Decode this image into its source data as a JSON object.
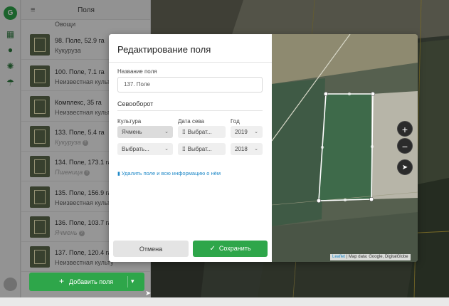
{
  "rail": {
    "logo_letter": "G",
    "icons": [
      "grid-icon",
      "pin-icon",
      "sun-icon",
      "umbrella-icon"
    ]
  },
  "panel": {
    "title": "Поля",
    "top_partial_crop": "Овощи",
    "fields": [
      {
        "name": "98. Поле, 52.9 га",
        "crop": "Кукуруза",
        "muted": false
      },
      {
        "name": "100. Поле, 7.1 га",
        "crop": "Неизвестная культу",
        "muted": false
      },
      {
        "name": "Комплекс, 35 га",
        "crop": "Неизвестная культу",
        "muted": false
      },
      {
        "name": "133. Поле, 5.4 га",
        "crop": "Кукуруза",
        "muted": true
      },
      {
        "name": "134. Поле, 173.1 га",
        "crop": "Пшеница",
        "muted": true
      },
      {
        "name": "135. Поле, 156.9 га",
        "crop": "Неизвестная культу",
        "muted": false
      },
      {
        "name": "136. Поле, 103.7 га",
        "crop": "Ячмень",
        "muted": true
      },
      {
        "name": "137. Поле, 120.4 га",
        "crop": "Неизвестная культу",
        "muted": false
      }
    ],
    "add_button": "Добавить поля"
  },
  "modal": {
    "title": "Редактирование поля",
    "field_name_label": "Название поля",
    "field_name_value": "137. Поле",
    "rotation_title": "Севооборот",
    "col_crop": "Культура",
    "col_date": "Дата сева",
    "col_year": "Год",
    "rows": [
      {
        "crop": "Ячмень",
        "date": "Выбрат...",
        "year": "2019"
      },
      {
        "crop": "Выбрать...",
        "date": "Выбрат...",
        "year": "2018"
      }
    ],
    "delete_link": "Удалить поле и всю информацию о нём",
    "cancel": "Отмена",
    "save": "Сохранить",
    "zoom_in": "+",
    "zoom_out": "−",
    "attribution_leaflet": "Leaflet",
    "attribution_rest": " | Map data: Google, DigitalGlobe"
  },
  "colors": {
    "accent": "#2ea64a",
    "link": "#1e88c7"
  }
}
